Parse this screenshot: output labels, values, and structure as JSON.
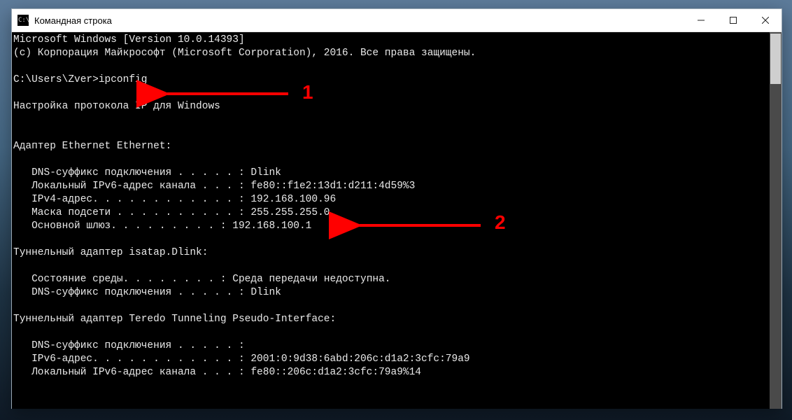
{
  "window": {
    "title": "Командная строка"
  },
  "console": {
    "banner1": "Microsoft Windows [Version 10.0.14393]",
    "banner2": "(c) Корпорация Майкрософт (Microsoft Corporation), 2016. Все права защищены.",
    "prompt": "C:\\Users\\Zver>",
    "command": "ipconfig",
    "heading": "Настройка протокола IP для Windows",
    "adapter1_title": "Адаптер Ethernet Ethernet:",
    "adapter1": {
      "dns_suffix_label": "   DNS-суффикс подключения . . . . . : ",
      "dns_suffix": "Dlink",
      "ipv6_local_label": "   Локальный IPv6-адрес канала . . . : ",
      "ipv6_local": "fe80::f1e2:13d1:d211:4d59%3",
      "ipv4_label": "   IPv4-адрес. . . . . . . . . . . . : ",
      "ipv4": "192.168.100.96",
      "mask_label": "   Маска подсети . . . . . . . . . . : ",
      "mask": "255.255.255.0",
      "gateway_label": "   Основной шлюз. . . . . . . . . : ",
      "gateway": "192.168.100.1"
    },
    "adapter2_title": "Туннельный адаптер isatap.Dlink:",
    "adapter2": {
      "state_label": "   Состояние среды. . . . . . . . : ",
      "state": "Среда передачи недоступна.",
      "dns_suffix_label": "   DNS-суффикс подключения . . . . . : ",
      "dns_suffix": "Dlink"
    },
    "adapter3_title": "Туннельный адаптер Teredo Tunneling Pseudo-Interface:",
    "adapter3": {
      "dns_suffix_label": "   DNS-суффикс подключения . . . . . :",
      "ipv6_label": "   IPv6-адрес. . . . . . . . . . . . : ",
      "ipv6": "2001:0:9d38:6abd:206c:d1a2:3cfc:79a9",
      "ipv6_local_label": "   Локальный IPv6-адрес канала . . . : ",
      "ipv6_local": "fe80::206c:d1a2:3cfc:79a9%14"
    }
  },
  "annotations": {
    "label1": "1",
    "label2": "2"
  }
}
